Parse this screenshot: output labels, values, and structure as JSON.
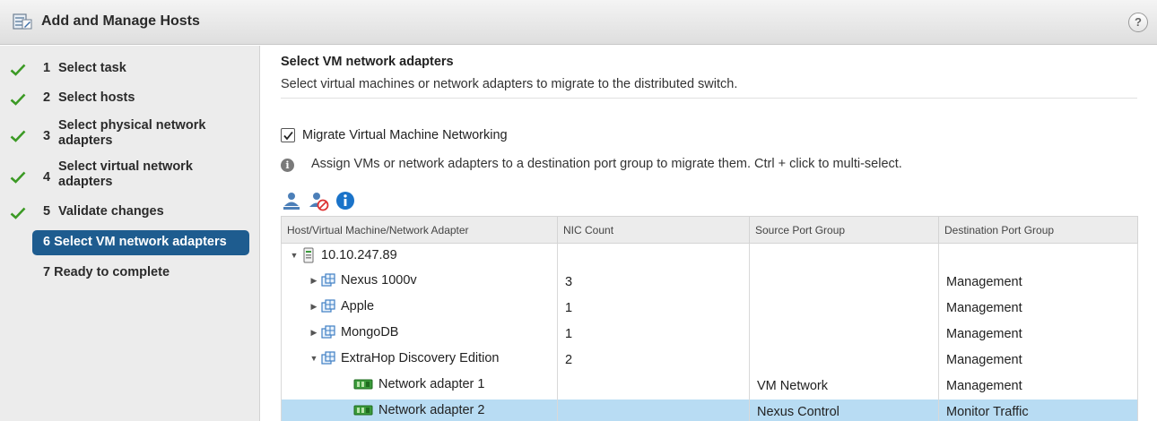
{
  "window": {
    "title": "Add and Manage Hosts",
    "help": "?"
  },
  "steps": [
    {
      "num": "1",
      "label": "Select task",
      "done": true
    },
    {
      "num": "2",
      "label": "Select hosts",
      "done": true
    },
    {
      "num": "3",
      "label": "Select physical network adapters",
      "done": true
    },
    {
      "num": "4",
      "label": "Select virtual network adapters",
      "done": true
    },
    {
      "num": "5",
      "label": "Validate changes",
      "done": true
    },
    {
      "label": "6 Select VM network adapters",
      "active": true
    },
    {
      "label": "7 Ready to complete"
    }
  ],
  "content": {
    "title": "Select VM network adapters",
    "subtitle": "Select virtual machines or network adapters to migrate to the distributed switch.",
    "migrate_checkbox": {
      "label": "Migrate Virtual Machine Networking",
      "checked": true
    },
    "info_text": "Assign VMs or network adapters to a destination port group to migrate them. Ctrl + click to multi-select.",
    "toolbar": [
      "assign-port-group-icon",
      "reset-changes-icon",
      "info-icon"
    ]
  },
  "table": {
    "columns": [
      "Host/Virtual Machine/Network Adapter",
      "NIC Count",
      "Source Port Group",
      "Destination Port Group"
    ],
    "rows": [
      {
        "name": "10.10.247.89",
        "kind": "host",
        "expander": "expanded",
        "nic": "",
        "source": "",
        "dest": ""
      },
      {
        "name": "Nexus 1000v",
        "kind": "vm",
        "expander": "collapsed",
        "nic": "3",
        "source": "",
        "dest": "Management"
      },
      {
        "name": "Apple",
        "kind": "vm",
        "expander": "collapsed",
        "nic": "1",
        "source": "",
        "dest": "Management"
      },
      {
        "name": "MongoDB",
        "kind": "vm",
        "expander": "collapsed",
        "nic": "1",
        "source": "",
        "dest": "Management"
      },
      {
        "name": "ExtraHop Discovery Edition",
        "kind": "vm",
        "expander": "expanded",
        "nic": "2",
        "source": "",
        "dest": "Management"
      },
      {
        "name": "Network adapter 1",
        "kind": "adapter",
        "nic": "",
        "source": "VM Network",
        "dest": "Management"
      },
      {
        "name": "Network adapter 2",
        "kind": "adapter",
        "nic": "",
        "source": "Nexus Control",
        "dest": "Monitor Traffic",
        "selected": true
      }
    ]
  },
  "colors": {
    "active_step": "#1e5c8f",
    "checkmark": "#3c9a25",
    "selected_row": "#b8dcf3",
    "info_blue": "#1a73c9"
  }
}
